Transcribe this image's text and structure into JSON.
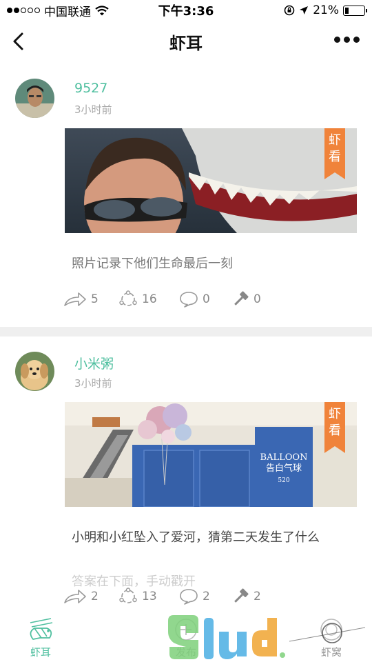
{
  "status_bar": {
    "carrier": "中国联通",
    "time": "下午3:36",
    "battery": "21%",
    "battery_level": 0.21
  },
  "nav": {
    "title": "虾耳"
  },
  "posts": [
    {
      "username": "9527",
      "time": "3小时前",
      "tag": "虾看",
      "caption": "照片记录下他们生命最后一刻",
      "shares": "5",
      "likes": "16",
      "comments": "0",
      "hammers": "0"
    },
    {
      "username": "小米粥",
      "time": "3小时前",
      "tag": "虾看",
      "caption": "小明和小红坠入了爱河，猜第二天发生了什么",
      "subcaption": "答案在下面，手动戳开",
      "sign_text_1": "BALLOON",
      "sign_text_2": "告白气球",
      "sign_text_3": "520",
      "shares": "2",
      "likes": "13",
      "comments": "2",
      "hammers": "2"
    }
  ],
  "tabs": [
    {
      "label": "虾耳"
    },
    {
      "label": "发布"
    },
    {
      "label": "虾窝"
    }
  ],
  "colors": {
    "accent": "#4fbf9f",
    "tag": "#f0833a",
    "divider": "#efefef"
  }
}
